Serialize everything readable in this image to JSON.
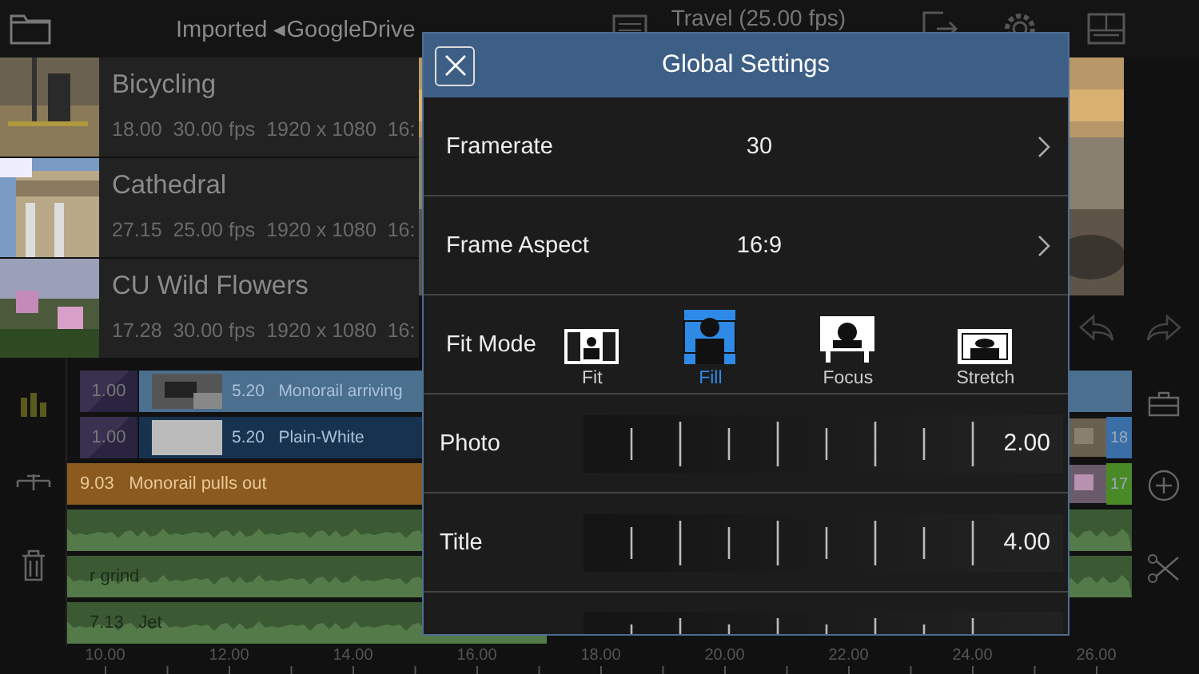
{
  "top_bar": {
    "breadcrumb": "Imported ◂GoogleDrive",
    "project_title": "Travel (25.00 fps)"
  },
  "media": [
    {
      "name": "Bicycling",
      "info": "18.00  30.00 fps  1920 x 1080  16:"
    },
    {
      "name": "Cathedral",
      "info": "27.15  25.00 fps  1920 x 1080  16:"
    },
    {
      "name": "CU Wild Flowers",
      "info": "17.28  30.00 fps  1920 x 1080  16:"
    }
  ],
  "tracks": [
    {
      "kind": "video",
      "clips": [
        {
          "kind": "transition",
          "label": "1.00"
        },
        {
          "kind": "clip",
          "label": "5.20   Monorail arriving",
          "color": "#4b6f8e"
        }
      ]
    },
    {
      "kind": "video",
      "clips": [
        {
          "kind": "transition",
          "label": "1.00"
        },
        {
          "kind": "title",
          "label": "5.20   Plain-White",
          "color": "#17324f"
        },
        {
          "kind": "tail",
          "badge": "18",
          "color": "#3a6ea6"
        }
      ]
    },
    {
      "kind": "audio",
      "clips": [
        {
          "kind": "clip",
          "label": "9.03   Monorail pulls out",
          "color": "#8a5a1e"
        },
        {
          "kind": "tail",
          "badge": "17",
          "color": "#4a8a26"
        }
      ]
    },
    {
      "kind": "audio",
      "clips": [
        {
          "kind": "wave",
          "color": "#3b5a33"
        }
      ]
    },
    {
      "kind": "audio",
      "clips": [
        {
          "kind": "wave",
          "label": "r grind",
          "color": "#3b5a33"
        }
      ]
    },
    {
      "kind": "audio",
      "clips": [
        {
          "kind": "short-wave",
          "label": "7.13   Jet",
          "color": "#3b5a33"
        }
      ]
    }
  ],
  "ruler": [
    "10.00",
    "12.00",
    "14.00",
    "16.00",
    "18.00",
    "20.00",
    "22.00",
    "24.00",
    "26.00"
  ],
  "dialog": {
    "title": "Global Settings",
    "rows": [
      {
        "kind": "choice",
        "label": "Framerate",
        "value": "30"
      },
      {
        "kind": "choice",
        "label": "Frame Aspect",
        "value": "16:9"
      },
      {
        "kind": "fit",
        "label": "Fit Mode",
        "options": [
          {
            "label": "Fit",
            "selected": false
          },
          {
            "label": "Fill",
            "selected": true
          },
          {
            "label": "Focus",
            "selected": false
          },
          {
            "label": "Stretch",
            "selected": false
          }
        ]
      },
      {
        "kind": "slider",
        "label": "Photo",
        "value": "2.00"
      },
      {
        "kind": "slider",
        "label": "Title",
        "value": "4.00"
      },
      {
        "kind": "slider"
      }
    ]
  }
}
